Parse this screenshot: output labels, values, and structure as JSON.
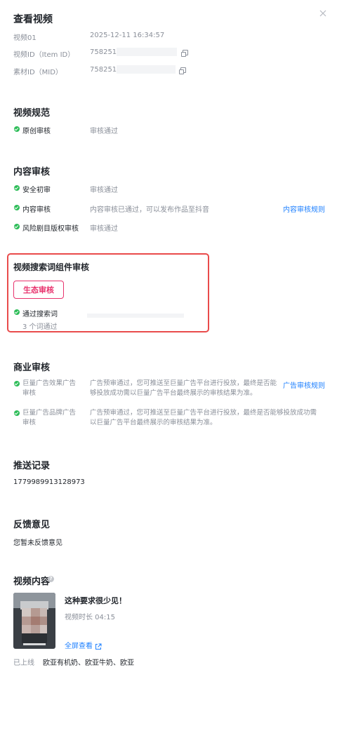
{
  "header": {
    "title": "查看视频",
    "close_icon": "close-icon"
  },
  "info": {
    "name_label": "视频01",
    "name_value": "2025-12-11 16:34:57",
    "item_id_label": "视频ID（Item ID）",
    "item_id_value": "758251",
    "mid_label": "素材ID（MID）",
    "mid_value": "758251"
  },
  "spec": {
    "title": "视频规范",
    "row_label": "原创审核",
    "row_status": "审核通过"
  },
  "content_review": {
    "title": "内容审核",
    "rows": [
      {
        "label": "安全初审",
        "status": "审核通过",
        "link": ""
      },
      {
        "label": "内容审核",
        "status": "内容审核已通过，可以发布作品至抖音",
        "link": "内容审核规则"
      },
      {
        "label": "风险剧目版权审核",
        "status": "审核通过",
        "link": ""
      }
    ]
  },
  "search_widget": {
    "title": "视频搜索词组件审核",
    "button": "生态审核",
    "row_label": "通过搜索词",
    "row_sub": "3 个词通过"
  },
  "business": {
    "title": "商业审核",
    "row1_label_a": "巨量广告效果广告",
    "row1_label_b": "审核",
    "row1_text_a": "广告预审通过，您可推送至巨量广告平台进行投放，最终是否能",
    "row1_text_b": "够投放成功需以巨量广告平台最终展示的审核结果为准。",
    "row1_link": "广告审核规则",
    "row2_label_a": "巨量广告品牌广告",
    "row2_label_b": "审核",
    "row2_text_a": "广告预审通过，您可推送至巨量广告平台进行投放，最终是否能够投放成功需",
    "row2_text_b": "以巨量广告平台最终展示的审核结果为准。"
  },
  "push": {
    "title": "推送记录",
    "value": "1779989913128973"
  },
  "feedback": {
    "title": "反馈意见",
    "value": "您暂未反馈意见"
  },
  "video": {
    "title": "视频内容",
    "help_icon": "question-circle-icon",
    "name": "这种要求很少见！",
    "duration": "视频时长 04:15",
    "fullscreen": "全屏查看",
    "fullscreen_icon": "external-link-icon",
    "status_label": "已上线",
    "tags": "欧亚有机奶、欧亚牛奶、欧亚"
  },
  "colors": {
    "accent": "#1e80ff",
    "success": "#2ebd59",
    "highlight_border": "#e94b4b",
    "pink_button": "#e8336d"
  }
}
